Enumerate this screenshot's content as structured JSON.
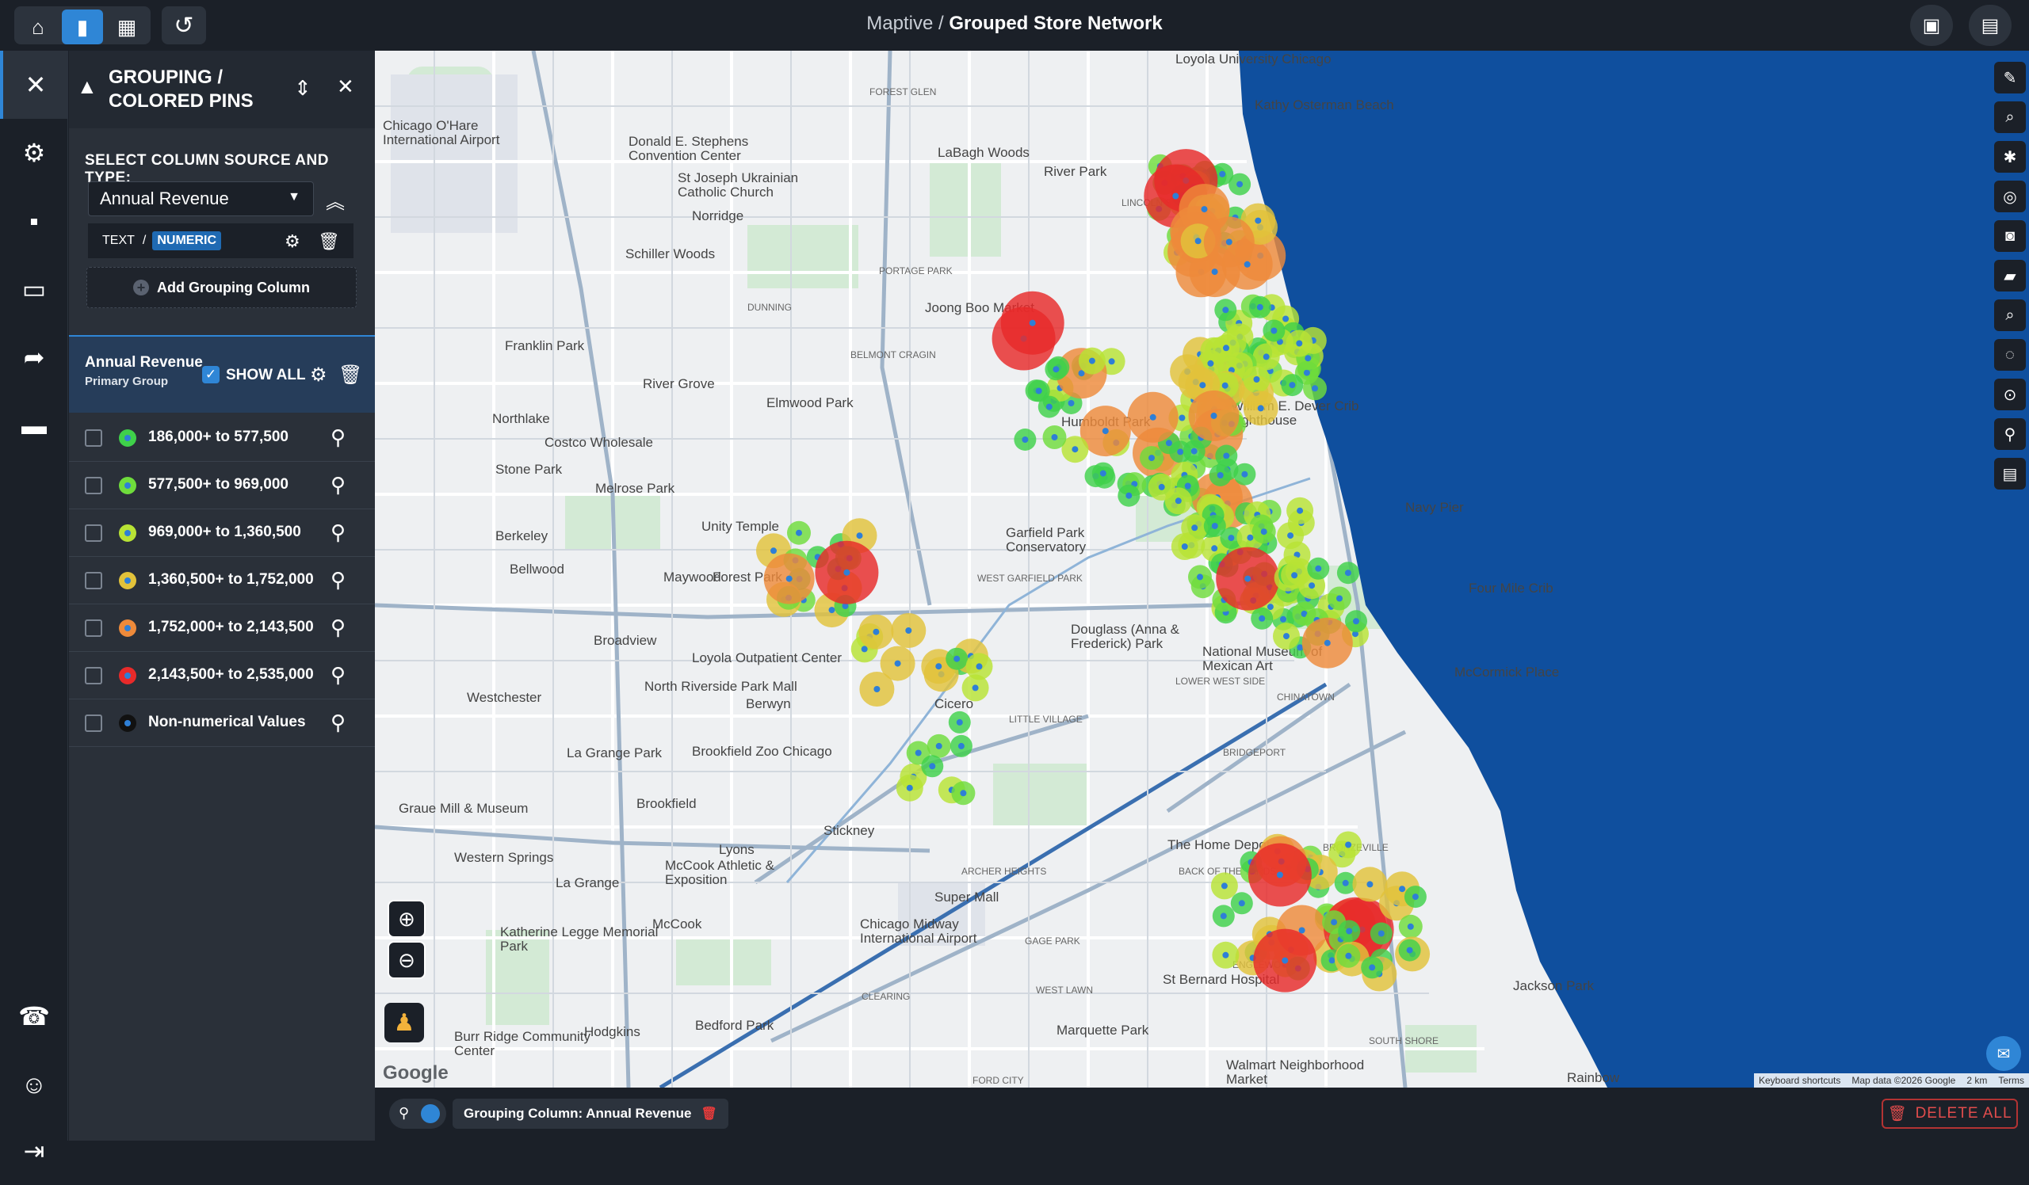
{
  "header": {
    "brand": "Maptive /",
    "map_name": "Grouped Store Network"
  },
  "panel": {
    "title_line1": "GROUPING /",
    "title_line2": "COLORED PINS",
    "select_label": "SELECT COLUMN SOURCE AND TYPE:",
    "column_value": "Annual Revenue",
    "type_text": "TEXT",
    "type_slash": "/",
    "type_numeric": "NUMERIC",
    "add_grouping": "Add Grouping Column",
    "group_title": "Annual Revenue",
    "group_subtitle": "Primary Group",
    "show_all": "SHOW ALL",
    "legend": [
      {
        "label": "186,000+ to 577,500",
        "color": "#3fd14a"
      },
      {
        "label": "577,500+ to 969,000",
        "color": "#6fdc3c"
      },
      {
        "label": "969,000+ to 1,360,500",
        "color": "#b8e335"
      },
      {
        "label": "1,360,500+ to 1,752,000",
        "color": "#e2c23a"
      },
      {
        "label": "1,752,000+ to 2,143,500",
        "color": "#ee8a3a"
      },
      {
        "label": "2,143,500+ to 2,535,000",
        "color": "#e82a2a"
      },
      {
        "label": "Non-numerical Values",
        "color": "#111111"
      }
    ]
  },
  "map": {
    "labels": [
      {
        "text": "Loyola University Chicago"
      },
      {
        "text": "Kathy Osterman Beach"
      },
      {
        "text": "FOREST GLEN"
      },
      {
        "text": "Donald E. Stephens Convention Center"
      },
      {
        "text": "LaBagh Woods"
      },
      {
        "text": "River Park"
      },
      {
        "text": "Chicago O'Hare International Airport"
      },
      {
        "text": "St Joseph Ukrainian Catholic Church"
      },
      {
        "text": "Norridge"
      },
      {
        "text": "LINCOLN SQUARE"
      },
      {
        "text": "Schiller Woods"
      },
      {
        "text": "PORTAGE PARK"
      },
      {
        "text": "DUNNING"
      },
      {
        "text": "Joong Boo Market"
      },
      {
        "text": "Franklin Park"
      },
      {
        "text": "BELMONT CRAGIN"
      },
      {
        "text": "River Grove"
      },
      {
        "text": "Elmwood Park"
      },
      {
        "text": "Northlake"
      },
      {
        "text": "William E. Dever Crib Lighthouse"
      },
      {
        "text": "Costco Wholesale"
      },
      {
        "text": "Stone Park"
      },
      {
        "text": "Melrose Park"
      },
      {
        "text": "Humboldt Park"
      },
      {
        "text": "Navy Pier"
      },
      {
        "text": "Unity Temple"
      },
      {
        "text": "Berkeley"
      },
      {
        "text": "Garfield Park Conservatory"
      },
      {
        "text": "Bellwood"
      },
      {
        "text": "Maywood"
      },
      {
        "text": "Forest Park"
      },
      {
        "text": "WEST GARFIELD PARK"
      },
      {
        "text": "Four Mile Crib"
      },
      {
        "text": "Broadview"
      },
      {
        "text": "Loyola Outpatient Center"
      },
      {
        "text": "Douglass (Anna & Frederick) Park"
      },
      {
        "text": "National Museum of Mexican Art"
      },
      {
        "text": "McCormick Place"
      },
      {
        "text": "Westchester"
      },
      {
        "text": "North Riverside Park Mall"
      },
      {
        "text": "Berwyn"
      },
      {
        "text": "Cicero"
      },
      {
        "text": "LOWER WEST SIDE"
      },
      {
        "text": "CHINATOWN"
      },
      {
        "text": "LITTLE VILLAGE"
      },
      {
        "text": "La Grange Park"
      },
      {
        "text": "Brookfield Zoo Chicago"
      },
      {
        "text": "BRIDGEPORT"
      },
      {
        "text": "Graue Mill & Museum"
      },
      {
        "text": "Brookfield"
      },
      {
        "text": "Stickney"
      },
      {
        "text": "BRONZEVILLE"
      },
      {
        "text": "The Home Depot"
      },
      {
        "text": "Western Springs"
      },
      {
        "text": "Lyons"
      },
      {
        "text": "McCook Athletic & Exposition"
      },
      {
        "text": "La Grange"
      },
      {
        "text": "ARCHER HEIGHTS"
      },
      {
        "text": "BACK OF THE YARDS"
      },
      {
        "text": "Super Mall"
      },
      {
        "text": "McCook"
      },
      {
        "text": "GAGE PARK"
      },
      {
        "text": "Katherine Legge Memorial Park"
      },
      {
        "text": "Chicago Midway International Airport"
      },
      {
        "text": "St Bernard Hospital"
      },
      {
        "text": "CLEARING"
      },
      {
        "text": "WEST LAWN"
      },
      {
        "text": "ENGLEWOOD"
      },
      {
        "text": "Jackson Park"
      },
      {
        "text": "Hodgkins"
      },
      {
        "text": "Bedford Park"
      },
      {
        "text": "Marquette Park"
      },
      {
        "text": "Burr Ridge Community Center"
      },
      {
        "text": "SOUTH SHORE"
      },
      {
        "text": "Walmart Neighborhood Market"
      },
      {
        "text": "FORD CITY"
      },
      {
        "text": "Rainbow"
      }
    ],
    "attribution": {
      "shortcuts": "Keyboard shortcuts",
      "data": "Map data ©2026 Google",
      "scale": "2 km",
      "terms": "Terms"
    },
    "logo": "Google"
  },
  "footer": {
    "chip_label": "Grouping Column: Annual Revenue",
    "delete_all": "DELETE ALL"
  },
  "colors": {
    "accent": "#2f86d6",
    "lake": "#0f4f9e",
    "red": "#e82a2a"
  }
}
